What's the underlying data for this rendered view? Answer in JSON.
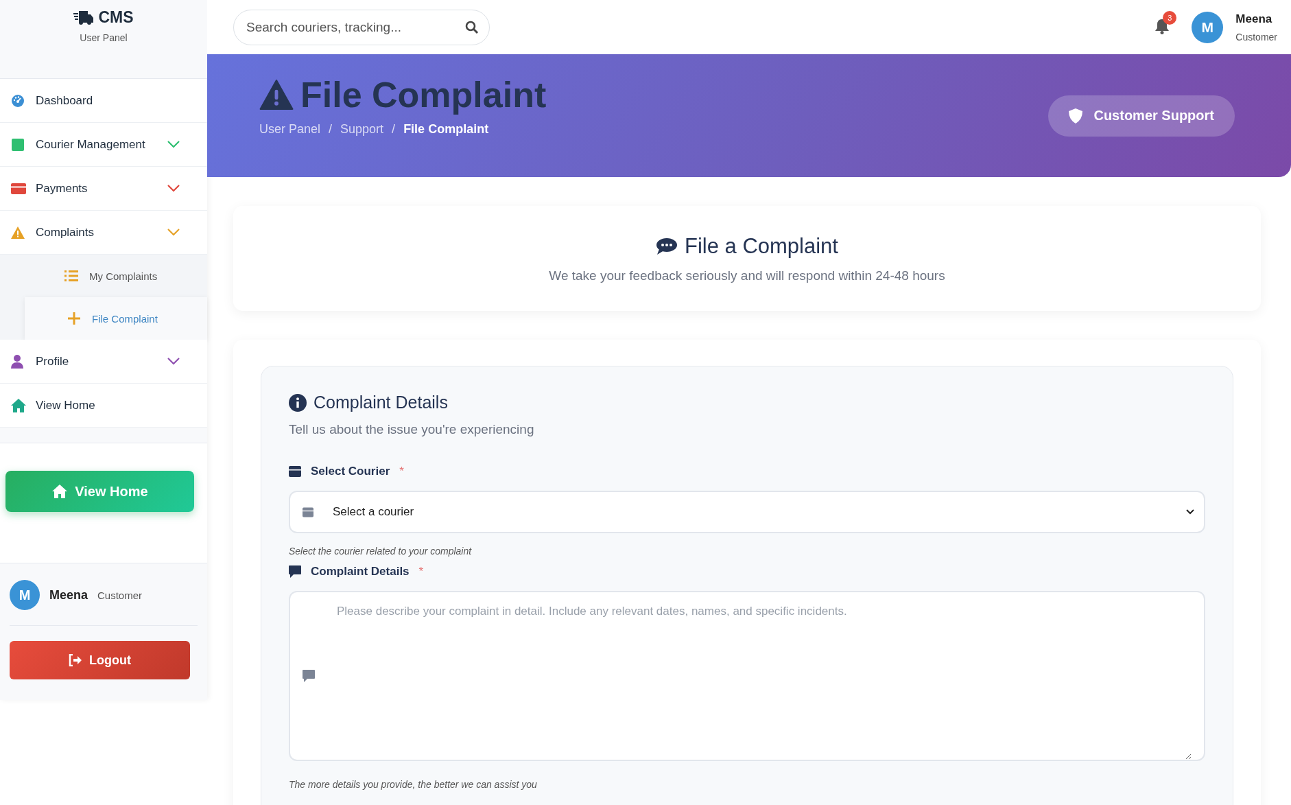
{
  "brand": {
    "title": "CMS",
    "subtitle": "User Panel"
  },
  "sidebar": {
    "items": [
      {
        "label": "Dashboard",
        "kind": "link",
        "color": "#3b8fd4"
      },
      {
        "label": "Courier Management",
        "kind": "group",
        "expanded": false,
        "color": "#2fbf71"
      },
      {
        "label": "Payments",
        "kind": "group",
        "expanded": false,
        "color": "#e0473c"
      },
      {
        "label": "Complaints",
        "kind": "group",
        "expanded": true,
        "color": "#e6a126",
        "children": [
          {
            "label": "My Complaints",
            "selected": false
          },
          {
            "label": "File Complaint",
            "selected": true
          }
        ]
      },
      {
        "label": "Profile",
        "kind": "group",
        "expanded": false,
        "color": "#8e4fb0"
      },
      {
        "label": "View Home",
        "kind": "link",
        "color": "#1fa88a"
      }
    ],
    "home_button": "View Home",
    "user": {
      "initial": "M",
      "name": "Meena",
      "role": "Customer"
    },
    "logout_button": "Logout"
  },
  "topbar": {
    "search": {
      "placeholder": "Search couriers, tracking..."
    },
    "notification_count": "3",
    "user": {
      "initial": "M",
      "name": "Meena",
      "role": "Customer"
    }
  },
  "banner": {
    "title": "File Complaint",
    "breadcrumb": [
      {
        "label": "User Panel",
        "selected": false
      },
      {
        "label": "Support",
        "selected": false
      },
      {
        "label": "File Complaint",
        "selected": true
      }
    ],
    "separator": "/",
    "button": "Customer Support"
  },
  "intro": {
    "title": "File a Complaint",
    "subtitle": "We take your feedback seriously and will respond within 24-48 hours"
  },
  "form": {
    "title": "Complaint Details",
    "subtitle": "Tell us about the issue you're experiencing",
    "fields": [
      {
        "kind": "select",
        "label": "Select Courier",
        "required_mark": "*",
        "value": "Select a courier",
        "hint": "Select the courier related to your complaint"
      },
      {
        "kind": "textarea",
        "label": "Complaint Details",
        "required_mark": "*",
        "placeholder": "Please describe your complaint in detail. Include any relevant dates, names, and specific incidents.",
        "hint": "The more details you provide, the better we can assist you"
      }
    ]
  }
}
